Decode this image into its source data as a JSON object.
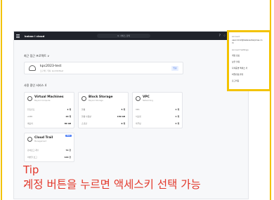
{
  "header": {
    "brand": "kakao i cloud",
    "search_placeholder": "Q. 서비스 검색",
    "icons": [
      "question-icon",
      "notification-icon",
      "settings-icon"
    ]
  },
  "projects": {
    "section_title": "최근 접근 프로젝트 ∨",
    "card": {
      "name": "kpc2023-test",
      "sub": "프로젝트 위치: kpc2023test",
      "button": "입장"
    }
  },
  "services": {
    "section_title": "사용 중인 서비스 4",
    "cards": [
      {
        "name": "Virtual Machines",
        "sub": "Beyond Compute",
        "rows": [
          {
            "k": "인스턴스",
            "v": "2 개"
          },
          {
            "k": "vCPU",
            "v": "20 개"
          },
          {
            "k": "메모리",
            "v": "80 GB"
          }
        ]
      },
      {
        "name": "Block Storage",
        "sub": "Beyond Storage",
        "rows": [
          {
            "k": "볼륨",
            "v": "5 개"
          },
          {
            "k": "볼륨 사용량",
            "v": "150 GB"
          },
          {
            "k": "스냅샷",
            "v": "0 개"
          }
        ]
      },
      {
        "name": "VPC",
        "sub": "Networking",
        "rows": [
          {
            "k": "VPC",
            "v": "1 개"
          },
          {
            "k": "서브넷",
            "v": "1 개"
          },
          {
            "k": "라우팅",
            "v": "4 개"
          }
        ]
      },
      {
        "name": "Cloud Trail",
        "sub": "Management",
        "badge": "New",
        "rows": [
          {
            "k": "감사로그 개수",
            "v": "72 건"
          },
          {
            "k": "이번달 로그",
            "v": "129 건"
          }
        ]
      }
    ]
  },
  "account_menu": {
    "email_label": "Account",
    "email": "user.1112@kakaoenterprise.co",
    "email_cont": "m",
    "section_label": "Account Settings",
    "items": [
      "계정 정보",
      "보안 설정",
      "자격증명 액세스 키",
      "비밀번호 변경",
      "로그아웃"
    ]
  },
  "tip": {
    "title": "Tip :",
    "text": "계정 버튼을 누르면 액세스키 선택 가능"
  }
}
